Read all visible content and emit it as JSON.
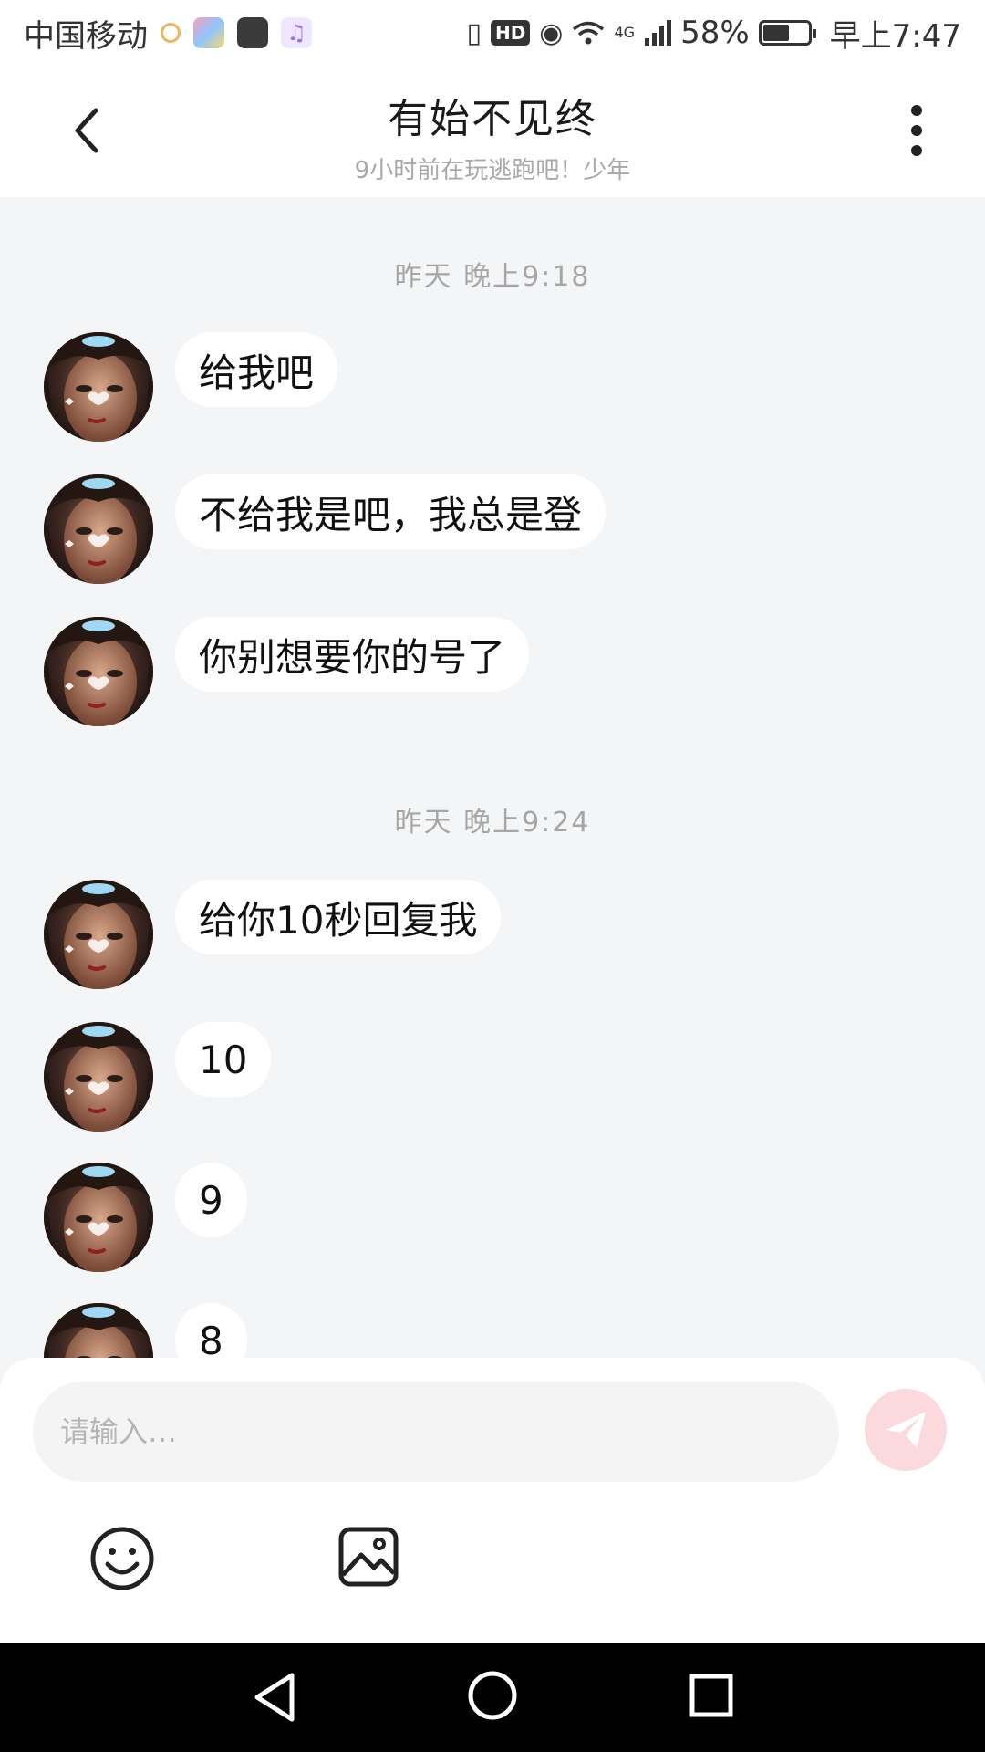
{
  "status_bar": {
    "carrier": "中国移动",
    "hd": "HD",
    "network": "4G",
    "battery_text": "58%",
    "battery_level": 0.58,
    "time": "早上7:47"
  },
  "header": {
    "title": "有始不见终",
    "subtitle": "9小时前在玩逃跑吧！少年"
  },
  "chat": {
    "sections": [
      {
        "time": "昨天 晚上9:18"
      },
      {
        "time": "昨天 晚上9:24"
      }
    ],
    "messages": [
      {
        "text": "给我吧"
      },
      {
        "text": "不给我是吧，我总是登"
      },
      {
        "text": "你别想要你的号了"
      },
      {
        "text": "给你10秒回复我"
      },
      {
        "text": "10"
      },
      {
        "text": "9"
      },
      {
        "text": "8"
      }
    ]
  },
  "input": {
    "placeholder": "请输入…"
  },
  "colors": {
    "chat_background": "#f4f5f7",
    "send_button": "#fbd9dc",
    "send_icon": "#ffffff"
  },
  "icons": {
    "back": "chevron-left-icon",
    "more": "more-vertical-icon",
    "send": "paper-plane-icon",
    "emoji": "smiley-icon",
    "image": "image-icon"
  }
}
